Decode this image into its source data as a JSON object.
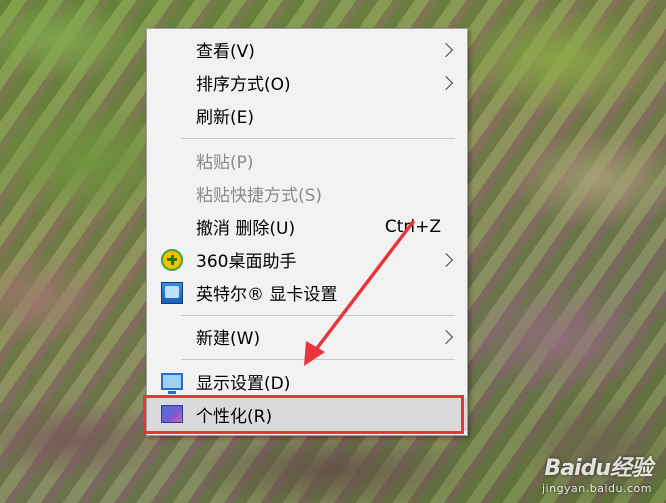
{
  "watermark": {
    "brand": "Baidu经验",
    "url": "jingyan.baidu.com"
  },
  "menu": {
    "items": [
      {
        "label": "查看(V)",
        "submenu": true
      },
      {
        "label": "排序方式(O)",
        "submenu": true
      },
      {
        "label": "刷新(E)"
      },
      {
        "label": "粘贴(P)",
        "disabled": true
      },
      {
        "label": "粘贴快捷方式(S)",
        "disabled": true
      },
      {
        "label": "撤消 删除(U)",
        "shortcut": "Ctrl+Z"
      },
      {
        "label": "360桌面助手",
        "icon": "360-icon",
        "submenu": true
      },
      {
        "label": "英特尔® 显卡设置",
        "icon": "intel-graphics-icon"
      },
      {
        "label": "新建(W)",
        "submenu": true
      },
      {
        "label": "显示设置(D)",
        "icon": "display-icon"
      },
      {
        "label": "个性化(R)",
        "icon": "personalize-icon",
        "selected": true
      }
    ]
  },
  "colors": {
    "highlight": "#e8343a",
    "menu_bg": "#f2f2f2",
    "selected_bg": "#dadada"
  }
}
